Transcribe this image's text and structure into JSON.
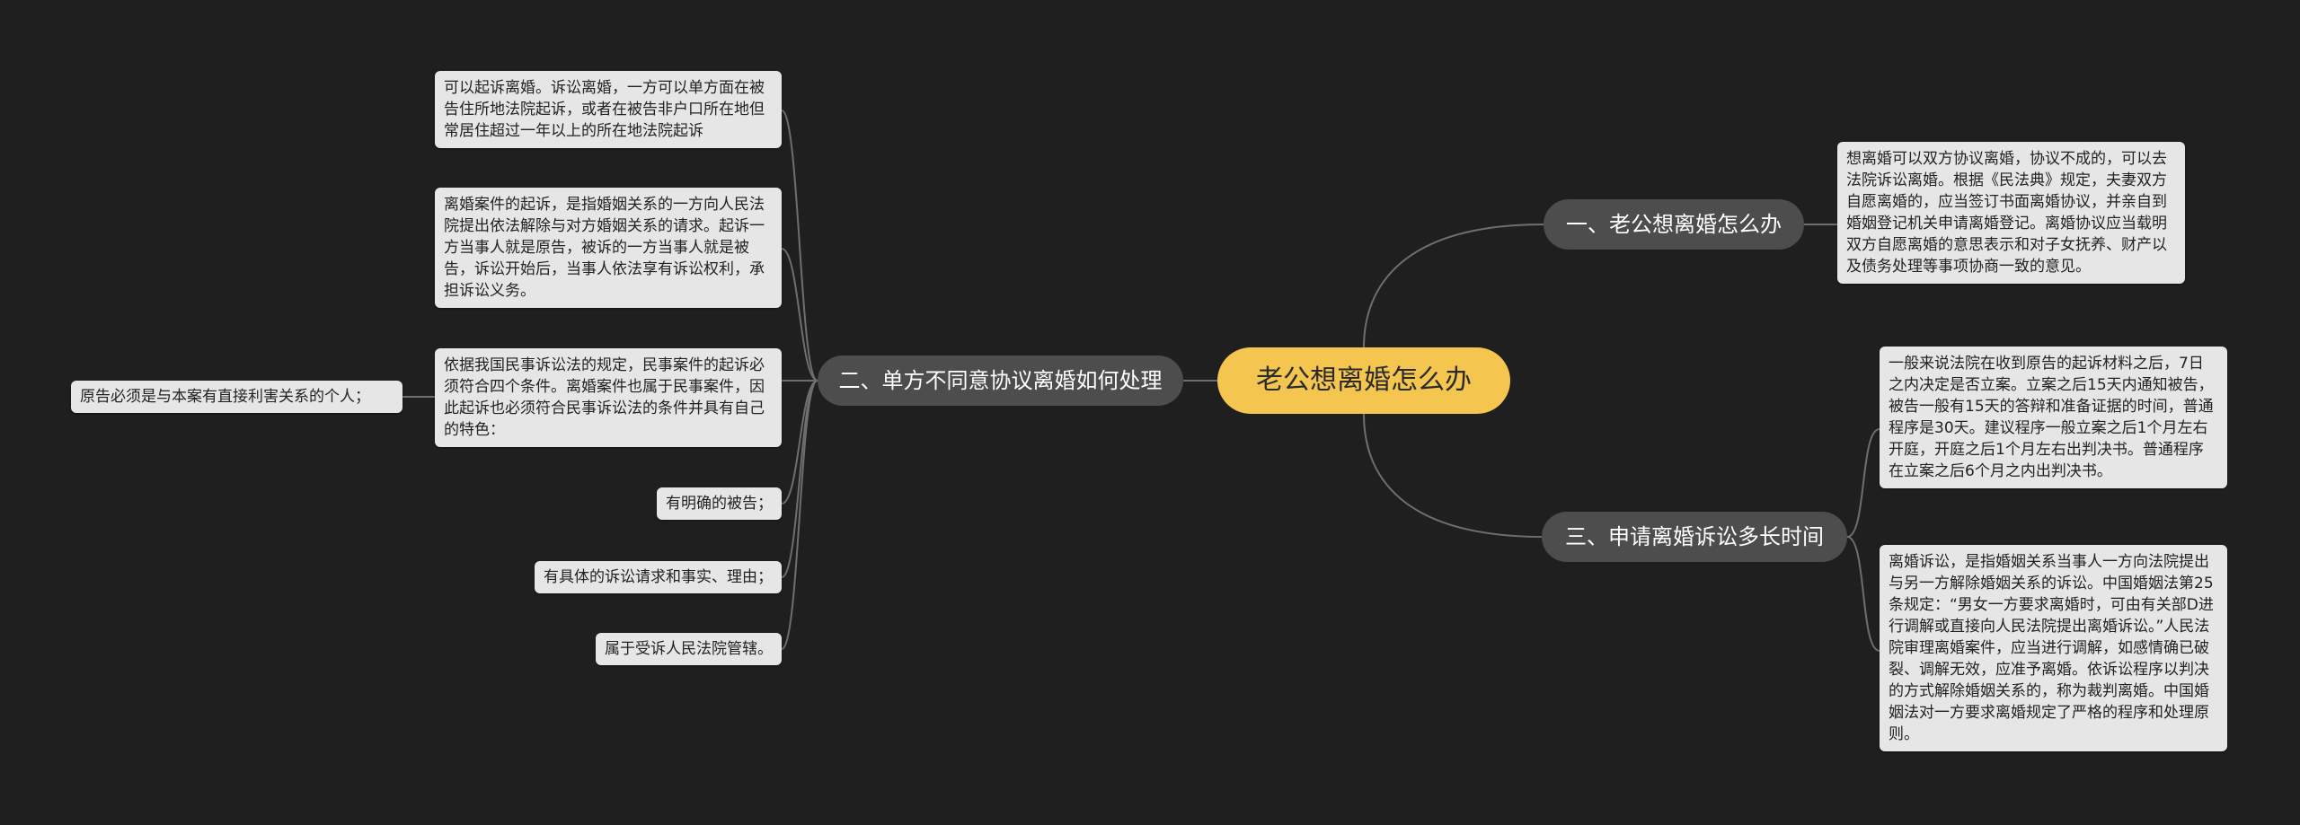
{
  "root": {
    "label": "老公想离婚怎么办"
  },
  "branches": [
    {
      "label": "一、老公想离婚怎么办",
      "leaves": [
        "想离婚可以双方协议离婚，协议不成的，可以去法院诉讼离婚。根据《民法典》规定，夫妻双方自愿离婚的，应当签订书面离婚协议，并亲自到婚姻登记机关申请离婚登记。离婚协议应当载明双方自愿离婚的意思表示和对子女抚养、财产以及债务处理等事项协商一致的意见。"
      ]
    },
    {
      "label": "二、单方不同意协议离婚如何处理",
      "leaves": [
        "可以起诉离婚。诉讼离婚，一方可以单方面在被告住所地法院起诉，或者在被告非户口所在地但常居住超过一年以上的所在地法院起诉",
        "离婚案件的起诉，是指婚姻关系的一方向人民法院提出依法解除与对方婚姻关系的请求。起诉一方当事人就是原告，被诉的一方当事人就是被告，诉讼开始后，当事人依法享有诉讼权利，承担诉讼义务。",
        "依据我国民事诉讼法的规定，民事案件的起诉必须符合四个条件。离婚案件也属于民事案件，因此起诉也必须符合民事诉讼法的条件并具有自己的特色：",
        "有明确的被告；",
        "有具体的诉讼请求和事实、理由；",
        "属于受诉人民法院管辖。"
      ],
      "sub_leaf": "原告必须是与本案有直接利害关系的个人；"
    },
    {
      "label": "三、申请离婚诉讼多长时间",
      "leaves": [
        "一般来说法院在收到原告的起诉材料之后，7日之内决定是否立案。立案之后15天内通知被告，被告一般有15天的答辩和准备证据的时间，普通程序是30天。建议程序一般立案之后1个月左右开庭，开庭之后1个月左右出判决书。普通程序在立案之后6个月之内出判决书。",
        "离婚诉讼，是指婚姻关系当事人一方向法院提出与另一方解除婚姻关系的诉讼。中国婚姻法第25条规定：“男女一方要求离婚时，可由有关部D进行调解或直接向人民法院提出离婚诉讼。”人民法院审理离婚案件，应当进行调解，如感情确已破裂、调解无效，应准予离婚。依诉讼程序以判决的方式解除婚姻关系的，称为裁判离婚。中国婚姻法对一方要求离婚规定了严格的程序和处理原则。"
      ]
    }
  ]
}
